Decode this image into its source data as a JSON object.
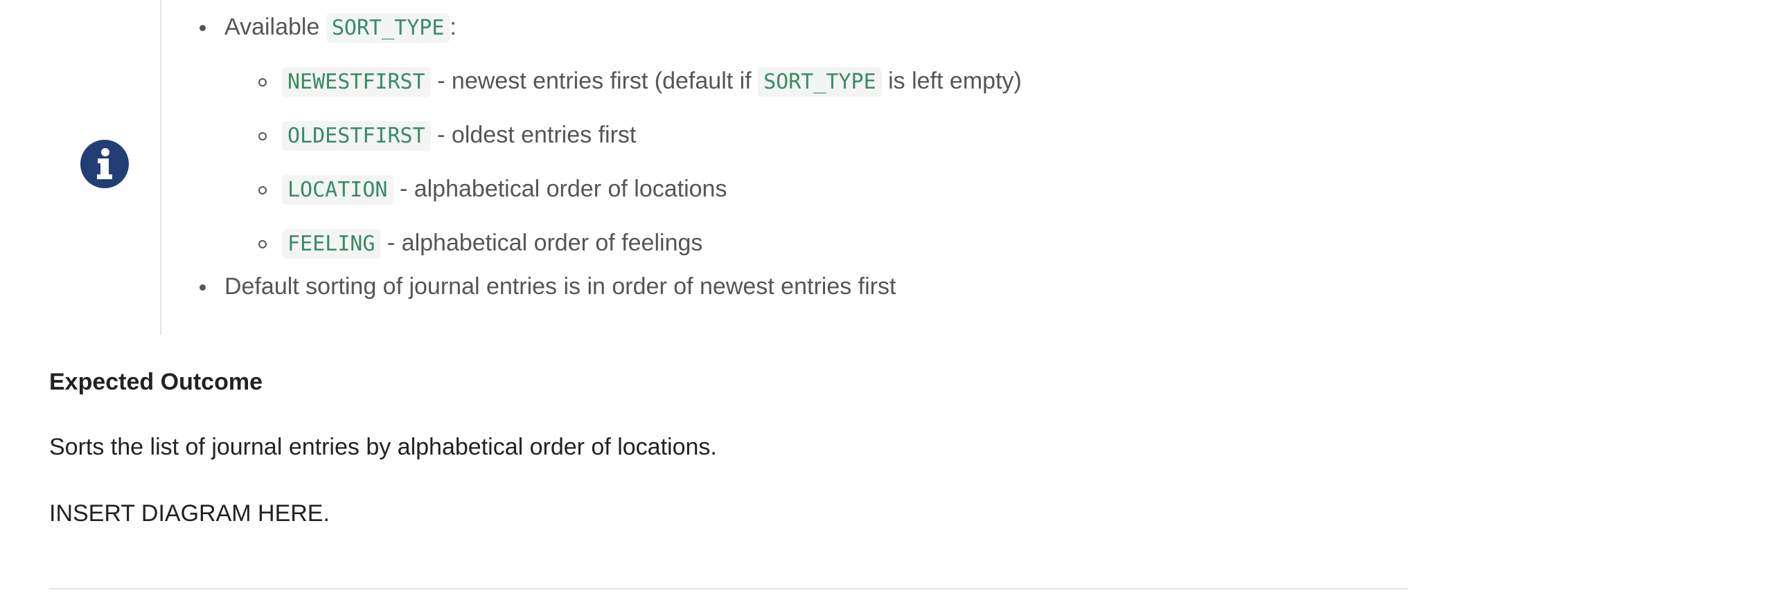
{
  "callout": {
    "icon": "info-circle-icon",
    "icon_color": "#213f75",
    "available_prefix": "Available",
    "available_code": "SORT_TYPE",
    "available_suffix": ":",
    "options": [
      {
        "code": "NEWESTFIRST",
        "desc_before": "- newest entries first (default if",
        "inline_code": "SORT_TYPE",
        "desc_after": "is left empty)"
      },
      {
        "code": "OLDESTFIRST",
        "desc": "- oldest entries first"
      },
      {
        "code": "LOCATION",
        "desc": "- alphabetical order of locations"
      },
      {
        "code": "FEELING",
        "desc": "- alphabetical order of feelings"
      }
    ],
    "default_note": "Default sorting of journal entries is in order of newest entries first"
  },
  "expected": {
    "heading": "Expected Outcome",
    "description": "Sorts the list of journal entries by alphabetical order of locations.",
    "diagram_placeholder": "INSERT DIAGRAM HERE."
  },
  "colors": {
    "code_text": "#3a8a66",
    "code_bg": "#f2f5f3",
    "body_text": "#555555",
    "heading_text": "#222222"
  }
}
